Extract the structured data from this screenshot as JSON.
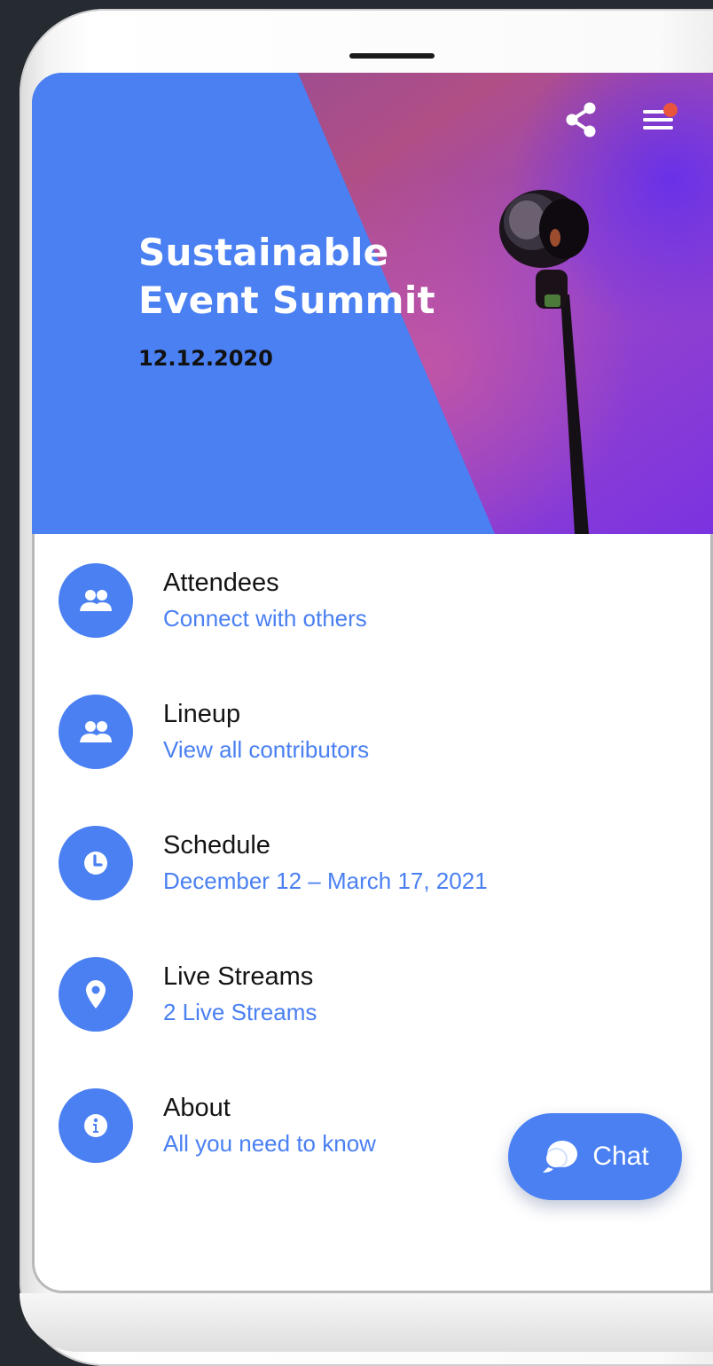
{
  "event": {
    "title_line1": "Sustainable",
    "title_line2": "Event Summit",
    "date": "12.12.2020"
  },
  "header": {
    "share_icon": "share-icon",
    "menu_icon": "menu-icon",
    "has_notification": true
  },
  "menu_items": [
    {
      "title": "Attendees",
      "subtitle": "Connect with others",
      "icon": "people-icon"
    },
    {
      "title": "Lineup",
      "subtitle": "View all contributors",
      "icon": "people-icon"
    },
    {
      "title": "Schedule",
      "subtitle": "December 12 – March 17, 2021",
      "icon": "clock-icon"
    },
    {
      "title": "Live Streams",
      "subtitle": "2 Live Streams",
      "icon": "location-pin-icon"
    },
    {
      "title": "About",
      "subtitle": "All you need to know",
      "icon": "info-icon"
    }
  ],
  "chat_button": {
    "label": "Chat",
    "icon": "chat-bubble-icon"
  },
  "colors": {
    "accent": "#4a80f2",
    "notification": "#e8553c",
    "background": "#252b31"
  }
}
